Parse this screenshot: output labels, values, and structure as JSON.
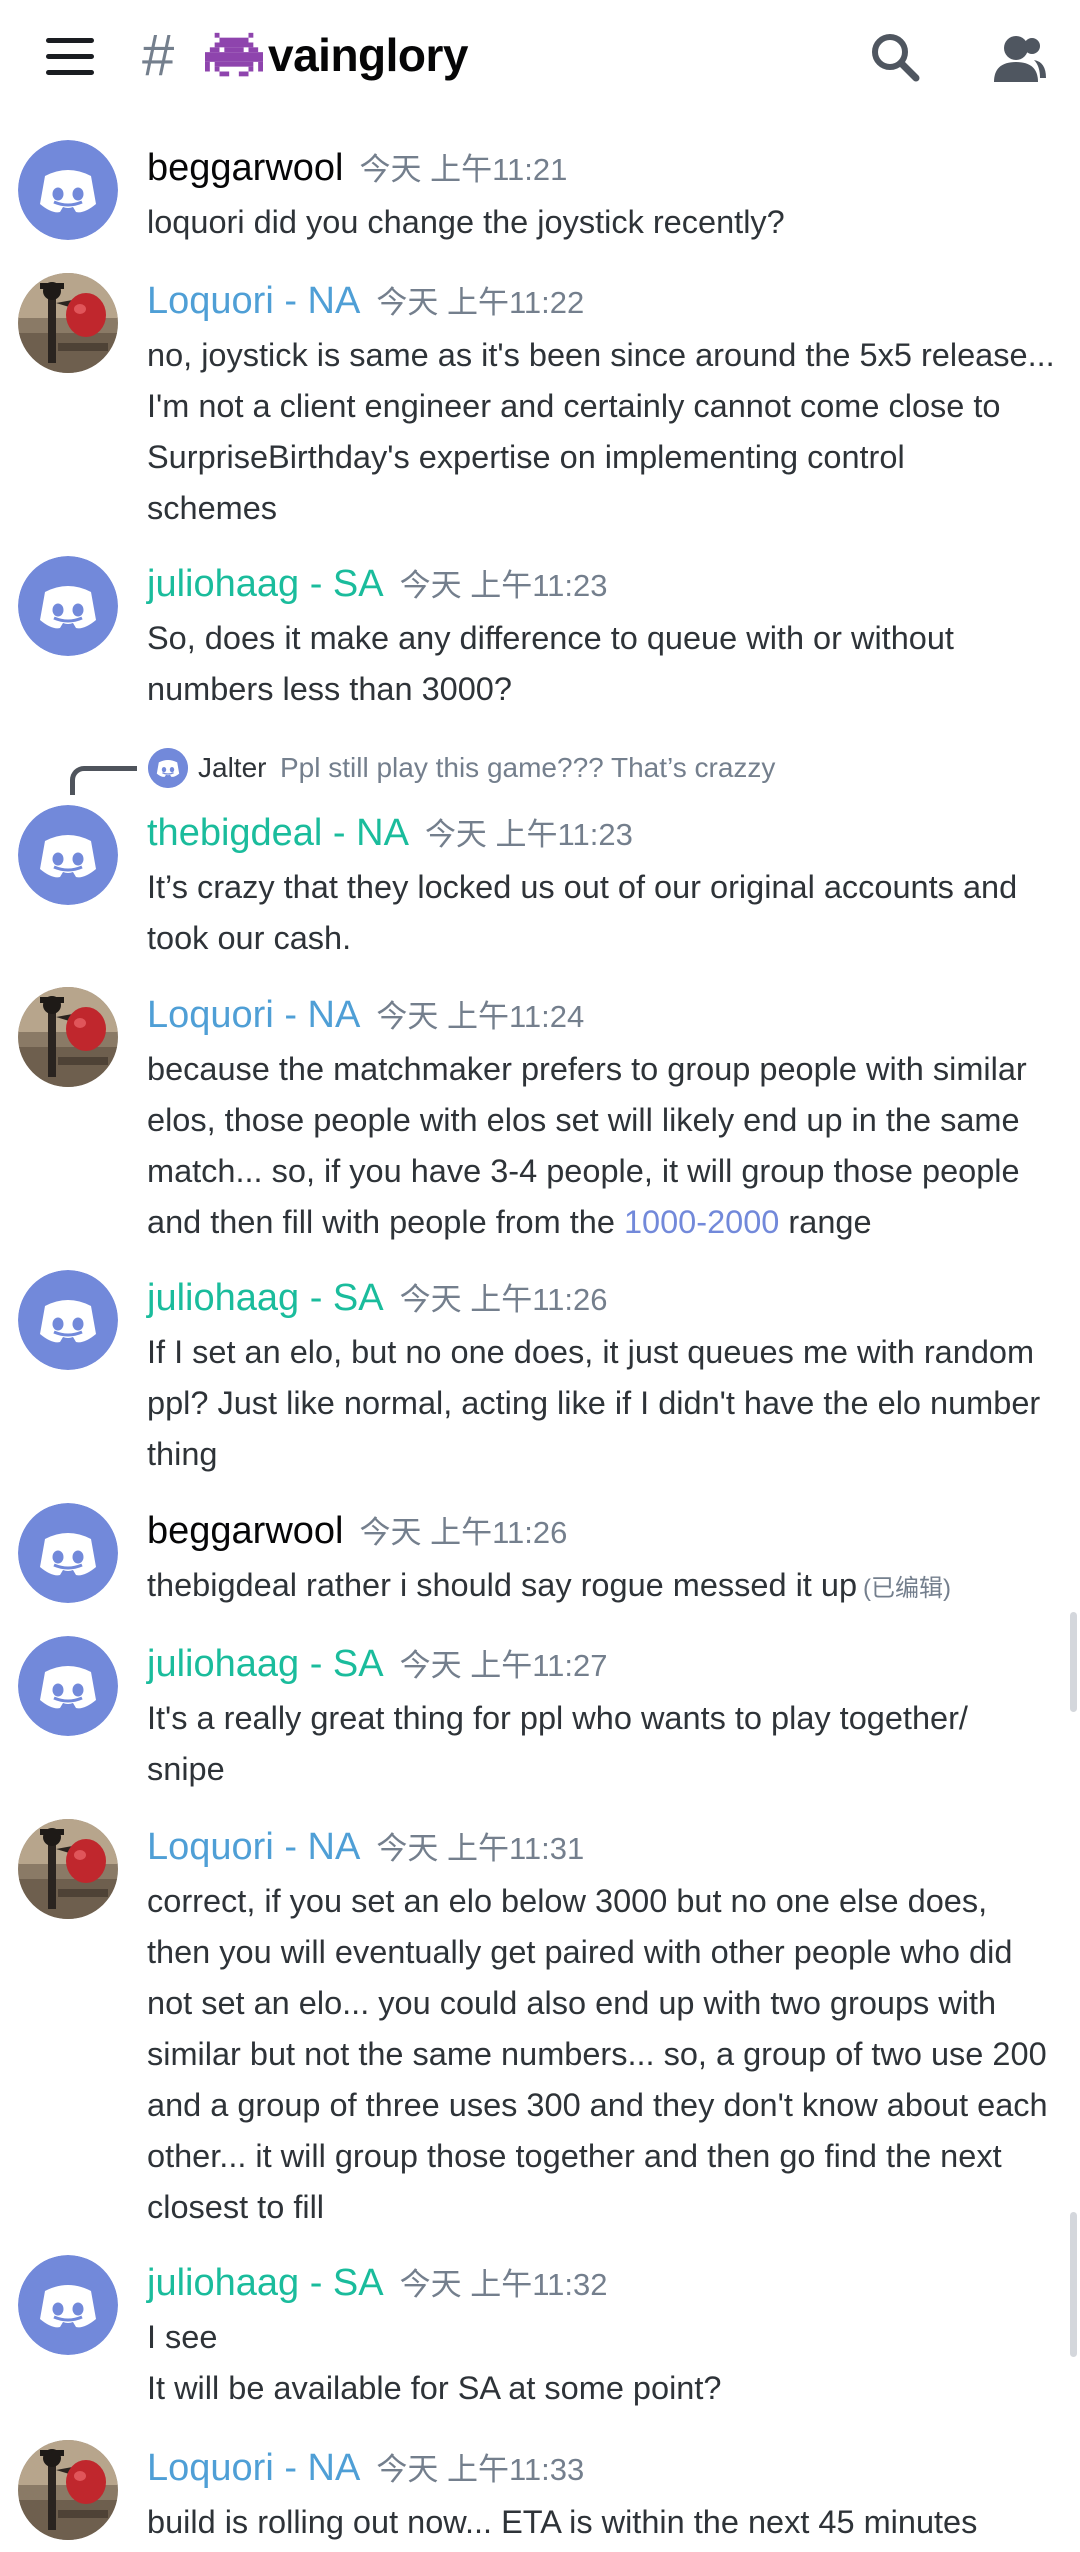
{
  "header": {
    "menu_icon": "hamburger-icon",
    "hash_symbol": "#",
    "channel_icon": "alien-monster-icon",
    "channel_name": "vainglory",
    "search_icon": "search-icon",
    "members_icon": "members-icon"
  },
  "colors": {
    "blurple": "#7289da",
    "blue_name": "#4f9fd6",
    "teal_name": "#1abc9c",
    "timestamp": "#747f8d"
  },
  "messages": [
    {
      "author": "beggarwool",
      "timestamp": "今天 上午11:21",
      "avatar": "discord-default-avatar",
      "lines": [
        "loquori did you change the joystick recently?"
      ]
    },
    {
      "author": "Loquori - NA",
      "timestamp": "今天 上午11:22",
      "avatar": "loquori-photo-avatar",
      "lines": [
        "no, joystick is same as it's been since around the 5x5 release...",
        "I'm not a client engineer and certainly cannot come close to",
        "SurpriseBirthday's expertise on implementing control",
        "schemes"
      ]
    },
    {
      "author": "juliohaag - SA",
      "timestamp": "今天 上午11:23",
      "avatar": "discord-default-avatar",
      "lines": [
        "So, does it make any difference to queue with or without",
        "numbers less than 3000?"
      ]
    },
    {
      "reply": {
        "author": "Jalter",
        "text": "Ppl still play this game??? That’s crazzy"
      },
      "author": "thebigdeal - NA",
      "timestamp": "今天 上午11:23",
      "avatar": "discord-default-avatar",
      "lines": [
        "It’s crazy that they locked us out of our original accounts and",
        "took our cash."
      ]
    },
    {
      "author": "Loquori - NA",
      "timestamp": "今天 上午11:24",
      "avatar": "loquori-photo-avatar",
      "lines": [
        "because the matchmaker prefers to group people with similar",
        "elos, those people with elos set will likely end up in the same",
        "match... so, if you have 3-4 people, it will group those people"
      ],
      "last_line_before": "and then fill with people from the ",
      "last_line_link": "1000-2000",
      "last_line_after": " range"
    },
    {
      "author": "juliohaag - SA",
      "timestamp": "今天 上午11:26",
      "avatar": "discord-default-avatar",
      "lines": [
        "If I set an elo, but no one does, it just queues me with random",
        "ppl? Just like normal, acting like if I didn't have the elo number",
        "thing"
      ]
    },
    {
      "author": "beggarwool",
      "timestamp": "今天 上午11:26",
      "avatar": "discord-default-avatar",
      "lines": [
        "thebigdeal rather i should say rogue messed it up"
      ],
      "edited": "(已编辑)"
    },
    {
      "author": "juliohaag - SA",
      "timestamp": "今天 上午11:27",
      "avatar": "discord-default-avatar",
      "lines": [
        "It's a really great thing for ppl who wants to play together/",
        "snipe"
      ]
    },
    {
      "author": "Loquori - NA",
      "timestamp": "今天 上午11:31",
      "avatar": "loquori-photo-avatar",
      "lines": [
        "correct, if you set an elo below 3000 but no one else does,",
        "then you will eventually get paired with other people who did",
        "not set an elo... you could also end up with two groups with",
        "similar but not the same numbers... so, a group of two use 200",
        "and a group of three uses 300 and they don't know about each",
        "other... it will group those together and then go find the next",
        "closest to fill"
      ]
    },
    {
      "author": "juliohaag - SA",
      "timestamp": "今天 上午11:32",
      "avatar": "discord-default-avatar",
      "lines": [
        "I see",
        "It will be available for SA at some point?"
      ]
    },
    {
      "author": "Loquori - NA",
      "timestamp": "今天 上午11:33",
      "avatar": "loquori-photo-avatar",
      "lines": [
        "build is rolling out now... ETA is within the next 45 minutes"
      ]
    }
  ]
}
